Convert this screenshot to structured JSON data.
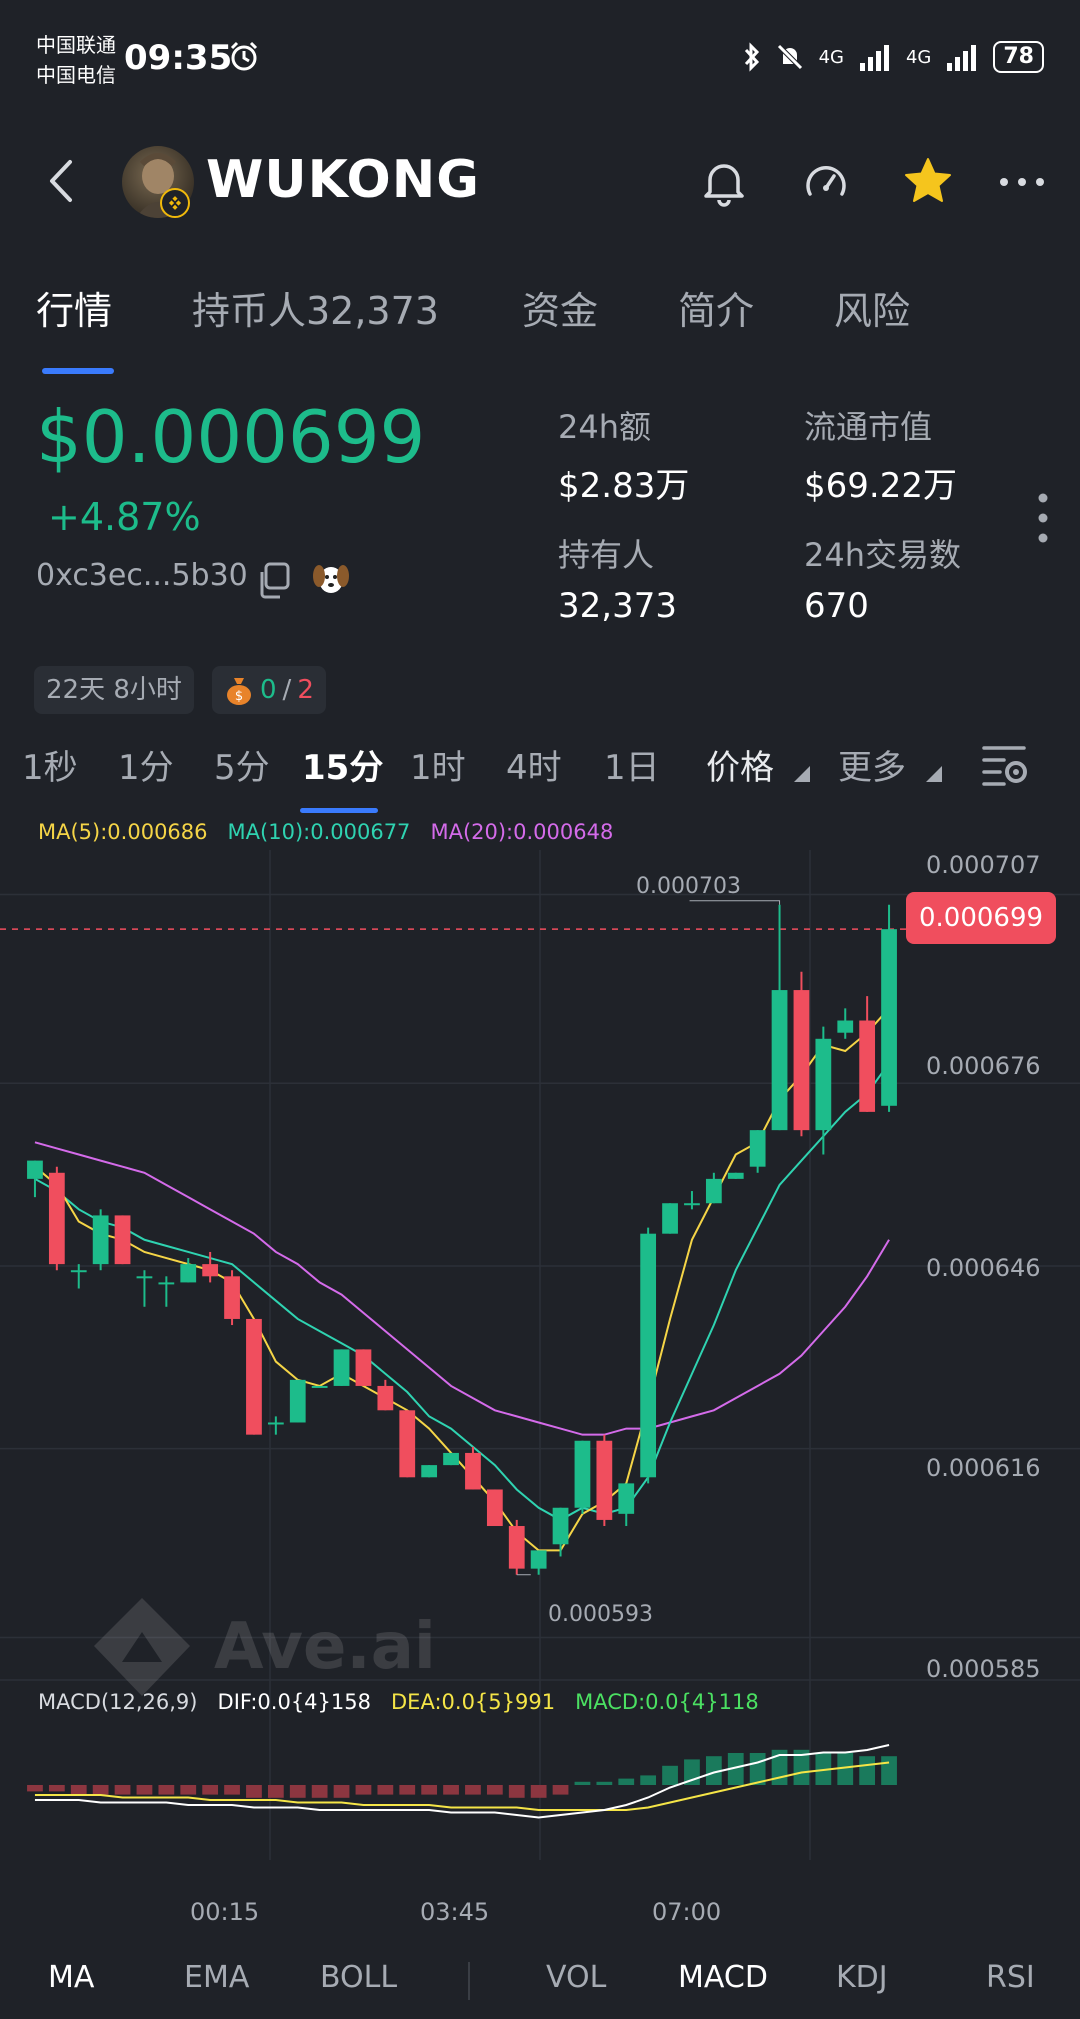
{
  "status_bar": {
    "carrier1": "中国联通",
    "carrier2": "中国电信",
    "time": "09:35",
    "net1": "4G",
    "net2": "4G",
    "battery": "78"
  },
  "header": {
    "title": "WUKONG",
    "icons": [
      "back-icon",
      "bell-icon",
      "gauge-icon",
      "star-icon",
      "more-icon"
    ],
    "star_color": "#f5c51d"
  },
  "tabs": [
    {
      "label": "行情",
      "active": true
    },
    {
      "label": "持币人32,373",
      "active": false
    },
    {
      "label": "资金",
      "active": false
    },
    {
      "label": "简介",
      "active": false
    },
    {
      "label": "风险",
      "active": false
    }
  ],
  "price_block": {
    "price": "$0.000699",
    "change": "+4.87%",
    "address": "0xc3ec...5b30",
    "price_color": "#1dbc8b"
  },
  "stats": [
    {
      "label": "24h额",
      "value": "$2.83万"
    },
    {
      "label": "流通市值",
      "value": "$69.22万"
    },
    {
      "label": "持有人",
      "value": "32,373"
    },
    {
      "label": "24h交易数",
      "value": "670"
    }
  ],
  "chips": {
    "age": "22天 8小时",
    "ratio_a": "0",
    "ratio_sep": "/",
    "ratio_b": "2"
  },
  "intervals": [
    {
      "label": "1秒"
    },
    {
      "label": "1分"
    },
    {
      "label": "5分"
    },
    {
      "label": "15分",
      "active": true
    },
    {
      "label": "1时"
    },
    {
      "label": "4时"
    },
    {
      "label": "1日"
    }
  ],
  "interval_extra": {
    "price": "价格",
    "more": "更多"
  },
  "ma_legend": {
    "ma5": "MA(5):0.000686",
    "ma10": "MA(10):0.000677",
    "ma20": "MA(20):0.000648"
  },
  "macd_legend": {
    "title": "MACD(12,26,9)",
    "dif": "DIF:0.0{4}158",
    "dea": "DEA:0.0{5}991",
    "macd": "MACD:0.0{4}118"
  },
  "watermark": "Ave.ai",
  "bottom_tabs": [
    {
      "label": "MA",
      "active": true
    },
    {
      "label": "EMA"
    },
    {
      "label": "BOLL"
    },
    {
      "label": "VOL"
    },
    {
      "label": "MACD",
      "active": true
    },
    {
      "label": "KDJ"
    },
    {
      "label": "RSI"
    }
  ],
  "chart_data": {
    "type": "candlestick",
    "y_ticks": [
      "0.000707",
      "0.000676",
      "0.000646",
      "0.000616",
      "0.000585"
    ],
    "x_ticks": [
      "00:15",
      "03:45",
      "07:00"
    ],
    "last_price_label": "0.000699",
    "high_label": "0.000703",
    "low_label": "0.000593",
    "colors": {
      "up": "#1dbc8b",
      "down": "#f04e5e",
      "ma5": "#f5d547",
      "ma10": "#2fd3b1",
      "ma20": "#d46bea"
    },
    "ylim": [
      0.000579,
      0.000712
    ],
    "candles": [
      {
        "o": 0.000658,
        "h": 0.000661,
        "l": 0.000655,
        "c": 0.000661
      },
      {
        "o": 0.000659,
        "h": 0.00066,
        "l": 0.000643,
        "c": 0.000644
      },
      {
        "o": 0.000643,
        "h": 0.000644,
        "l": 0.00064,
        "c": 0.000643
      },
      {
        "o": 0.000644,
        "h": 0.000653,
        "l": 0.000643,
        "c": 0.000652
      },
      {
        "o": 0.000652,
        "h": 0.000652,
        "l": 0.000644,
        "c": 0.000644
      },
      {
        "o": 0.000642,
        "h": 0.000643,
        "l": 0.000637,
        "c": 0.000642
      },
      {
        "o": 0.000641,
        "h": 0.000642,
        "l": 0.000637,
        "c": 0.000641
      },
      {
        "o": 0.000641,
        "h": 0.000645,
        "l": 0.000641,
        "c": 0.000644
      },
      {
        "o": 0.000644,
        "h": 0.000646,
        "l": 0.000641,
        "c": 0.000642
      },
      {
        "o": 0.000642,
        "h": 0.000643,
        "l": 0.000634,
        "c": 0.000635
      },
      {
        "o": 0.000635,
        "h": 0.000635,
        "l": 0.000616,
        "c": 0.000616
      },
      {
        "o": 0.000618,
        "h": 0.000619,
        "l": 0.000616,
        "c": 0.000618
      },
      {
        "o": 0.000618,
        "h": 0.000625,
        "l": 0.000618,
        "c": 0.000625
      },
      {
        "o": 0.000624,
        "h": 0.000624,
        "l": 0.000624,
        "c": 0.000624
      },
      {
        "o": 0.000624,
        "h": 0.00063,
        "l": 0.000624,
        "c": 0.00063
      },
      {
        "o": 0.00063,
        "h": 0.00063,
        "l": 0.000624,
        "c": 0.000624
      },
      {
        "o": 0.000624,
        "h": 0.000625,
        "l": 0.00062,
        "c": 0.00062
      },
      {
        "o": 0.00062,
        "h": 0.00062,
        "l": 0.000609,
        "c": 0.000609
      },
      {
        "o": 0.000609,
        "h": 0.000611,
        "l": 0.000609,
        "c": 0.000611
      },
      {
        "o": 0.000611,
        "h": 0.000613,
        "l": 0.000611,
        "c": 0.000613
      },
      {
        "o": 0.000613,
        "h": 0.000614,
        "l": 0.000607,
        "c": 0.000607
      },
      {
        "o": 0.000607,
        "h": 0.000607,
        "l": 0.000601,
        "c": 0.000601
      },
      {
        "o": 0.000601,
        "h": 0.000602,
        "l": 0.000593,
        "c": 0.000594
      },
      {
        "o": 0.000594,
        "h": 0.000597,
        "l": 0.000593,
        "c": 0.000597
      },
      {
        "o": 0.000598,
        "h": 0.000604,
        "l": 0.000596,
        "c": 0.000604
      },
      {
        "o": 0.000604,
        "h": 0.000615,
        "l": 0.000603,
        "c": 0.000615
      },
      {
        "o": 0.000615,
        "h": 0.000616,
        "l": 0.000601,
        "c": 0.000602
      },
      {
        "o": 0.000603,
        "h": 0.000608,
        "l": 0.000601,
        "c": 0.000608
      },
      {
        "o": 0.000609,
        "h": 0.00065,
        "l": 0.000608,
        "c": 0.000649
      },
      {
        "o": 0.000649,
        "h": 0.000654,
        "l": 0.000649,
        "c": 0.000654
      },
      {
        "o": 0.000654,
        "h": 0.000656,
        "l": 0.000653,
        "c": 0.000654
      },
      {
        "o": 0.000654,
        "h": 0.000659,
        "l": 0.000654,
        "c": 0.000658
      },
      {
        "o": 0.000658,
        "h": 0.000659,
        "l": 0.000658,
        "c": 0.000659
      },
      {
        "o": 0.00066,
        "h": 0.000666,
        "l": 0.000659,
        "c": 0.000666
      },
      {
        "o": 0.000666,
        "h": 0.000703,
        "l": 0.000666,
        "c": 0.000689
      },
      {
        "o": 0.000689,
        "h": 0.000692,
        "l": 0.000665,
        "c": 0.000666
      },
      {
        "o": 0.000666,
        "h": 0.000683,
        "l": 0.000662,
        "c": 0.000681
      },
      {
        "o": 0.000682,
        "h": 0.000686,
        "l": 0.000681,
        "c": 0.000684
      },
      {
        "o": 0.000684,
        "h": 0.000688,
        "l": 0.000669,
        "c": 0.000669
      },
      {
        "o": 0.00067,
        "h": 0.000703,
        "l": 0.000669,
        "c": 0.000699
      }
    ],
    "ma5": [
      0.00066,
      0.000657,
      0.000651,
      0.000649,
      0.000648,
      0.000646,
      0.000645,
      0.000644,
      0.000643,
      0.000641,
      0.000635,
      0.000628,
      0.000625,
      0.000624,
      0.000626,
      0.000624,
      0.000622,
      0.00062,
      0.000617,
      0.000613,
      0.000609,
      0.000605,
      0.0006,
      0.000597,
      0.000597,
      0.000603,
      0.000605,
      0.000608,
      0.000621,
      0.000635,
      0.000648,
      0.000655,
      0.000662,
      0.000664,
      0.000671,
      0.000675,
      0.00068,
      0.000679,
      0.000682,
      0.000686
    ],
    "ma10": [
      0.000658,
      0.000656,
      0.000653,
      0.000651,
      0.00065,
      0.000648,
      0.000647,
      0.000646,
      0.000645,
      0.000644,
      0.000641,
      0.000638,
      0.000635,
      0.000633,
      0.000631,
      0.000629,
      0.000626,
      0.000623,
      0.000619,
      0.000617,
      0.000614,
      0.000611,
      0.000607,
      0.000604,
      0.000602,
      0.000604,
      0.000603,
      0.000604,
      0.000609,
      0.000618,
      0.000626,
      0.000634,
      0.000643,
      0.00065,
      0.000657,
      0.000661,
      0.000665,
      0.000669,
      0.000672,
      0.000677
    ],
    "ma20": [
      0.000664,
      0.000663,
      0.000662,
      0.000661,
      0.00066,
      0.000659,
      0.000657,
      0.000655,
      0.000653,
      0.000651,
      0.000649,
      0.000646,
      0.000644,
      0.000641,
      0.000639,
      0.000636,
      0.000633,
      0.00063,
      0.000627,
      0.000624,
      0.000622,
      0.00062,
      0.000619,
      0.000618,
      0.000617,
      0.000616,
      0.000616,
      0.000617,
      0.000617,
      0.000618,
      0.000619,
      0.00062,
      0.000622,
      0.000624,
      0.000626,
      0.000629,
      0.000633,
      0.000637,
      0.000642,
      0.000648
    ],
    "macd_hist": [
      -2,
      -2,
      -3,
      -3,
      -3,
      -3,
      -3,
      -3,
      -3,
      -3,
      -4,
      -4,
      -4,
      -4,
      -4,
      -3,
      -3,
      -3,
      -3,
      -3,
      -3,
      -3,
      -4,
      -4,
      -3,
      1,
      1,
      2,
      3,
      6,
      8,
      9,
      10,
      10,
      11,
      11,
      10,
      10,
      9,
      9
    ],
    "dif": [
      -6,
      -6,
      -6,
      -7,
      -7,
      -7,
      -7,
      -8,
      -8,
      -8,
      -9,
      -9,
      -9,
      -10,
      -10,
      -10,
      -10,
      -10,
      -10,
      -11,
      -11,
      -11,
      -12,
      -13,
      -12,
      -11,
      -10,
      -8,
      -5,
      -1,
      2,
      5,
      7,
      9,
      12,
      12,
      13,
      13,
      14,
      16
    ],
    "dea": [
      -4,
      -4,
      -4,
      -4,
      -5,
      -5,
      -5,
      -5,
      -6,
      -6,
      -6,
      -6,
      -7,
      -7,
      -7,
      -8,
      -8,
      -8,
      -8,
      -9,
      -9,
      -9,
      -9,
      -10,
      -10,
      -10,
      -10,
      -10,
      -9,
      -7,
      -5,
      -3,
      -1,
      1,
      3,
      5,
      6,
      7,
      8,
      9
    ]
  }
}
